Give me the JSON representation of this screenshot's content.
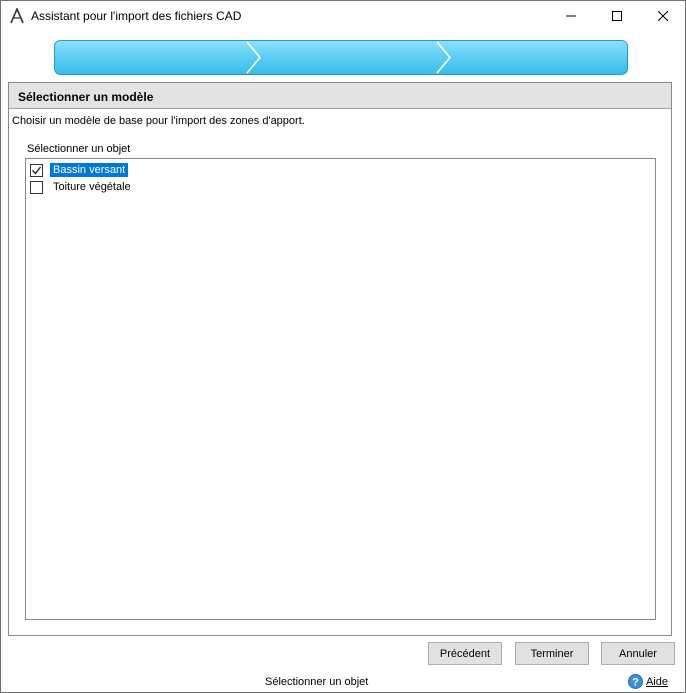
{
  "window": {
    "title": "Assistant pour l'import des fichiers CAD",
    "app_icon": "cad-a-icon"
  },
  "titlebar_buttons": {
    "minimize_icon": "minimize-icon",
    "maximize_icon": "maximize-icon",
    "close_icon": "close-icon"
  },
  "progress": {
    "steps": 3,
    "color": "#5bcdf3"
  },
  "section": {
    "title": "Sélectionner un modèle",
    "description": "Choisir un modèle de base pour l'import des zones d'apport."
  },
  "list": {
    "caption": "Sélectionner un objet",
    "items": [
      {
        "label": "Bassin versant",
        "checked": true,
        "selected": true
      },
      {
        "label": "Toiture végétale",
        "checked": false,
        "selected": false
      }
    ]
  },
  "buttons": {
    "previous": "Précédent",
    "finish": "Terminer",
    "cancel": "Annuler"
  },
  "status": {
    "text": "Sélectionner un objet",
    "help_label": "Aide",
    "help_icon": "help-icon"
  },
  "colors": {
    "selection": "#0078d7",
    "progress_fill": "#5bcdf3",
    "header_bg": "#e3e3e3"
  }
}
